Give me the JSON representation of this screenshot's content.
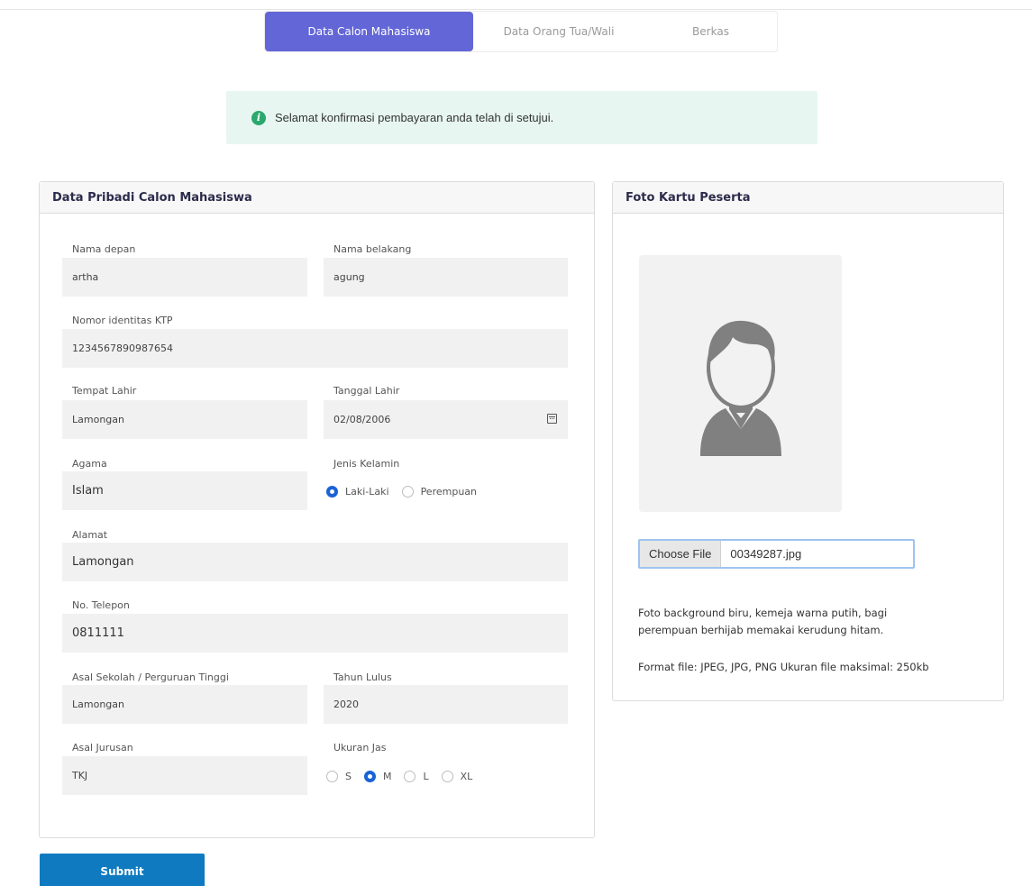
{
  "tabs": [
    {
      "label": "Data Calon Mahasiswa",
      "active": true
    },
    {
      "label": "Data Orang Tua/Wali",
      "active": false
    },
    {
      "label": "Berkas",
      "active": false
    }
  ],
  "alert": {
    "icon": "info-icon",
    "text": "Selamat konfirmasi pembayaran anda telah di setujui.",
    "color": "#2aa86d"
  },
  "personal": {
    "title": "Data Pribadi Calon Mahasiswa",
    "first_name": {
      "label": "Nama depan",
      "value": "artha"
    },
    "last_name": {
      "label": "Nama belakang",
      "value": "agung"
    },
    "ktp": {
      "label": "Nomor identitas KTP",
      "value": "1234567890987654"
    },
    "birth_place": {
      "label": "Tempat Lahir",
      "value": "Lamongan"
    },
    "birth_date": {
      "label": "Tanggal Lahir",
      "value": "02/08/2006"
    },
    "religion": {
      "label": "Agama",
      "value": "Islam"
    },
    "gender": {
      "label": "Jenis Kelamin",
      "options": [
        "Laki-Laki",
        "Perempuan"
      ],
      "selected": "Laki-Laki"
    },
    "address": {
      "label": "Alamat",
      "value": "Lamongan"
    },
    "phone": {
      "label": "No. Telepon",
      "value": "0811111"
    },
    "school": {
      "label": "Asal Sekolah / Perguruan Tinggi",
      "value": "Lamongan"
    },
    "grad_year": {
      "label": "Tahun Lulus",
      "value": "2020"
    },
    "major": {
      "label": "Asal Jurusan",
      "value": "TKJ"
    },
    "jacket_size": {
      "label": "Ukuran Jas",
      "options": [
        "S",
        "M",
        "L",
        "XL"
      ],
      "selected": "M"
    }
  },
  "photo_card": {
    "title": "Foto Kartu Peserta",
    "choose_label": "Choose File",
    "file_name": "00349287.jpg",
    "note_1": "Foto background biru, kemeja warna putih, bagi perempuan berhijab memakai kerudung hitam.",
    "note_2": "Format file: JPEG, JPG, PNG Ukuran file maksimal: 250kb"
  },
  "submit_label": "Submit",
  "colors": {
    "accent": "#6366d6",
    "submit": "#0f7ac0",
    "alert_bg": "#e7f6f1",
    "radio": "#1a63d6"
  }
}
